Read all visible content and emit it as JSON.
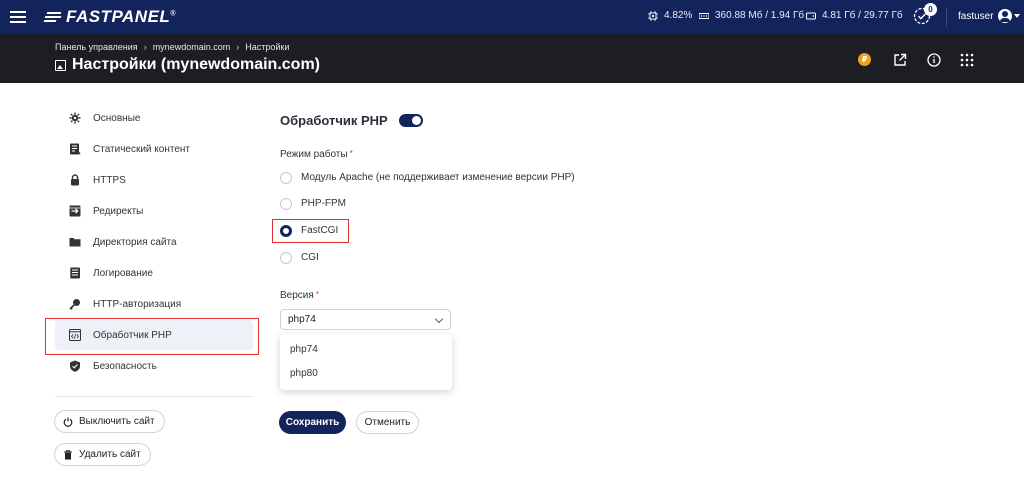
{
  "topbar": {
    "logo_text": "FASTPANEL",
    "logo_reg": "®",
    "cpu": "4.82%",
    "ram": "360.88 Мб / 1.94 Гб",
    "disk": "4.81 Гб / 29.77 Гб",
    "tasks_count": "0",
    "username": "fastuser"
  },
  "header": {
    "breadcrumbs": [
      "Панель управления",
      "mynewdomain.com",
      "Настройки"
    ],
    "breadcrumb_sep": "›",
    "title": "Настройки (mynewdomain.com)",
    "coin_symbol": "₽"
  },
  "sidebar": {
    "items": [
      {
        "label": "Основные",
        "icon": "gear-icon"
      },
      {
        "label": "Статический контент",
        "icon": "document-icon"
      },
      {
        "label": "HTTPS",
        "icon": "lock-icon"
      },
      {
        "label": "Редиректы",
        "icon": "redirect-icon"
      },
      {
        "label": "Директория сайта",
        "icon": "folder-icon"
      },
      {
        "label": "Логирование",
        "icon": "log-icon"
      },
      {
        "label": "HTTP-авторизация",
        "icon": "key-icon"
      },
      {
        "label": "Обработчик PHP",
        "icon": "code-icon"
      },
      {
        "label": "Безопасность",
        "icon": "shield-icon"
      }
    ],
    "active_index": 7,
    "disable_site": "Выключить сайт",
    "delete_site": "Удалить сайт"
  },
  "main": {
    "section_title": "Обработчик PHP",
    "toggle_on": true,
    "mode_label": "Режим работы",
    "required_mark": "*",
    "modes": [
      "Модуль Apache (не поддерживает изменение версии PHP)",
      "PHP-FPM",
      "FastCGI",
      "CGI"
    ],
    "selected_mode": "FastCGI",
    "version_label": "Версия",
    "version_value": "php74",
    "version_options": [
      "php74",
      "php80"
    ],
    "save": "Сохранить",
    "cancel": "Отменить"
  },
  "colors": {
    "navy": "#13235c",
    "header_dark": "#1c1e24",
    "highlight_red": "#e0302f",
    "coin": "#f0a21a"
  }
}
